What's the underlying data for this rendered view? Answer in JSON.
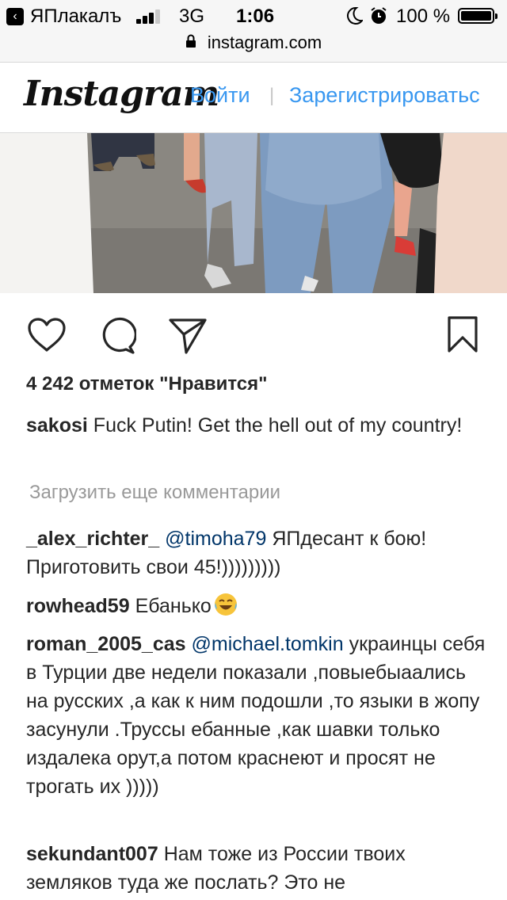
{
  "status_bar": {
    "back_app": "ЯПлакалъ",
    "network": "3G",
    "time": "1:06",
    "battery": "100 %"
  },
  "browser": {
    "url": "instagram.com"
  },
  "header": {
    "logo": "Instagram",
    "login": "Войти",
    "separator": "|",
    "signup": "Зарегистрироватьс"
  },
  "post": {
    "likes": "4 242 отметок \"Нравится\"",
    "caption": {
      "user": "sakosi",
      "text": "Fuck Putin! Get the hell out of my country!"
    },
    "load_more": "Загрузить еще комментарии",
    "comments": [
      {
        "user": "_alex_richter_",
        "mention": "@timoha79",
        "text": "ЯПдесант к бою! Приготовить свои 45!)))))))))"
      },
      {
        "user": "rowhead59",
        "mention": "",
        "text": "Ебанько"
      },
      {
        "user": "roman_2005_cas",
        "mention": "@michael.tomkin",
        "text": "украинцы себя в Турции две недели показали ,повыебыаались на русских ,а как к ним подошли ,то языки в жопу засунули .Труссы ебанные ,как шавки только издалека орут,а потом краснеют и просят не трогать их )))))"
      },
      {
        "user": "sekundant007",
        "mention": "",
        "text": "Нам тоже из России твоих земляков туда же послать? Это не"
      }
    ]
  },
  "colors": {
    "link": "#3897f0",
    "mention": "#003569",
    "muted": "#999999",
    "text": "#262626"
  },
  "icons": [
    "chevron-left-icon",
    "signal-icon",
    "moon-icon",
    "alarm-icon",
    "battery-icon",
    "lock-icon",
    "heart-icon",
    "comment-icon",
    "share-icon",
    "bookmark-icon",
    "laughing-emoji-icon"
  ]
}
